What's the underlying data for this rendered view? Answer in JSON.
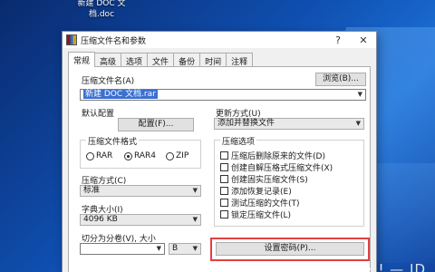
{
  "desktop": {
    "icon_label": "新建 DOC 文\n档.doc"
  },
  "window": {
    "title": "压缩文件名和参数",
    "help_label": "?",
    "close_label": "✕",
    "tabs": [
      "常规",
      "高级",
      "选项",
      "文件",
      "备份",
      "时间",
      "注释"
    ]
  },
  "general": {
    "archive_name_label": "压缩文件名(A)",
    "archive_name_value": "新建 DOC 文档.rar",
    "browse_label": "浏览(B)...",
    "default_profile_label": "默认配置",
    "profile_button_label": "配置(F)...",
    "update_mode_label": "更新方式(U)",
    "update_mode_value": "添加并替换文件",
    "format_group_label": "压缩文件格式",
    "format_options": [
      "RAR",
      "RAR4",
      "ZIP"
    ],
    "format_selected": "RAR4",
    "method_label": "压缩方式(C)",
    "method_value": "标准",
    "dict_label": "字典大小(I)",
    "dict_value": "4096 KB",
    "split_label": "切分为分卷(V), 大小",
    "split_value": "",
    "split_unit": "B",
    "options_group_label": "压缩选项",
    "options": [
      "压缩后删除原来的文件(D)",
      "创建自解压格式压缩文件(X)",
      "创建固实压缩文件(S)",
      "添加恢复记录(E)",
      "测试压缩的文件(T)",
      "锁定压缩文件(L)"
    ],
    "set_password_label": "设置密码(P)..."
  },
  "watermark": "• . 4 — — · ! — ID"
}
